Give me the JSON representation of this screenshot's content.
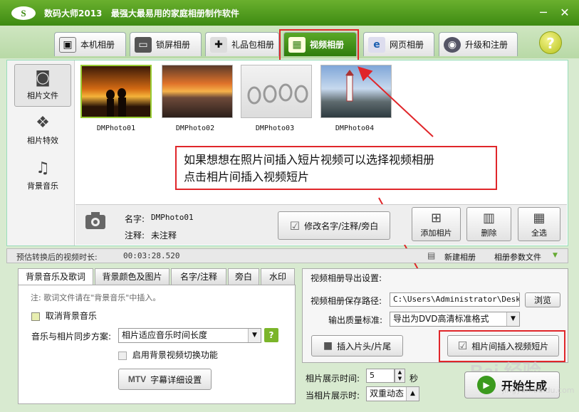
{
  "app": {
    "logo_text": "S",
    "title": "数码大师2013   最强大最易用的家庭相册制作软件"
  },
  "window_buttons": {
    "minimize": "─",
    "close": "✕"
  },
  "tabs": [
    {
      "label": "本机相册",
      "icon": "portrait-icon",
      "glyph": "▣"
    },
    {
      "label": "锁屏相册",
      "icon": "monitor-icon",
      "glyph": "▭"
    },
    {
      "label": "礼品包相册",
      "icon": "gift-icon",
      "glyph": "✚"
    },
    {
      "label": "视频相册",
      "icon": "film-icon",
      "glyph": "▦"
    },
    {
      "label": "网页相册",
      "icon": "ie-icon",
      "glyph": "e"
    },
    {
      "label": "升级和注册",
      "icon": "globe-icon",
      "glyph": "◉"
    }
  ],
  "help_label": "?",
  "sidebar": [
    {
      "label": "相片文件",
      "icon": "camera-icon",
      "glyph": "◙"
    },
    {
      "label": "相片特效",
      "icon": "effects-icon",
      "glyph": "❖"
    },
    {
      "label": "背景音乐",
      "icon": "music-note-icon",
      "glyph": "♫"
    }
  ],
  "photos": [
    "DMPhoto01",
    "DMPhoto02",
    "DMPhoto03",
    "DMPhoto04"
  ],
  "annotation": {
    "line1": "如果想想在照片间插入短片视频可以选择视频相册",
    "line2": "点击相片间插入视频短片"
  },
  "info": {
    "name_label": "名字:",
    "name_value": "DMPhoto01",
    "note_label": "注释:",
    "note_value": "未注释"
  },
  "buttons": {
    "edit_name": "修改名字/注释/旁白",
    "add_photo": "添加相片",
    "delete": "删除",
    "select_all": "全选"
  },
  "status": {
    "duration_label": "预估转换后的视频时长:",
    "duration_value": "00:03:28.520",
    "new_album": "新建相册",
    "param_file": "相册参数文件"
  },
  "subtabs": [
    "背景音乐及歌词",
    "背景颜色及图片",
    "名字/注释",
    "旁白",
    "水印"
  ],
  "music": {
    "note": "注: 歌词文件请在\"背景音乐\"中插入。",
    "cancel_bg_music": "取消背景音乐",
    "sync_label": "音乐与相片同步方案:",
    "sync_value": "相片适应音乐时间长度",
    "sync_help": "?",
    "enable_switch": "启用背景视频切换功能",
    "subtitle_btn_prefix": "MTV",
    "subtitle_btn": "字幕详细设置"
  },
  "export": {
    "heading": "视频相册导出设置:",
    "path_label": "视频相册保存路径:",
    "path_value": "C:\\Users\\Administrator\\Desktop",
    "browse": "浏览",
    "quality_label": "输出质量标准:",
    "quality_value": "导出为DVD高清标准格式",
    "insert_head": "插入片头/片尾",
    "insert_between": "相片间插入视频短片"
  },
  "timing": {
    "display_time_label": "相片展示时间:",
    "display_time_value": "5",
    "seconds": "秒",
    "when_label": "当相片展示时:",
    "when_value": "双重动态"
  },
  "start_button": "开始生成",
  "watermark": {
    "brand": "Bai 经验",
    "url": "jingyan.baidu.com"
  },
  "colors": {
    "accent_green": "#3d8a12",
    "annotation_red": "#e0262a"
  }
}
